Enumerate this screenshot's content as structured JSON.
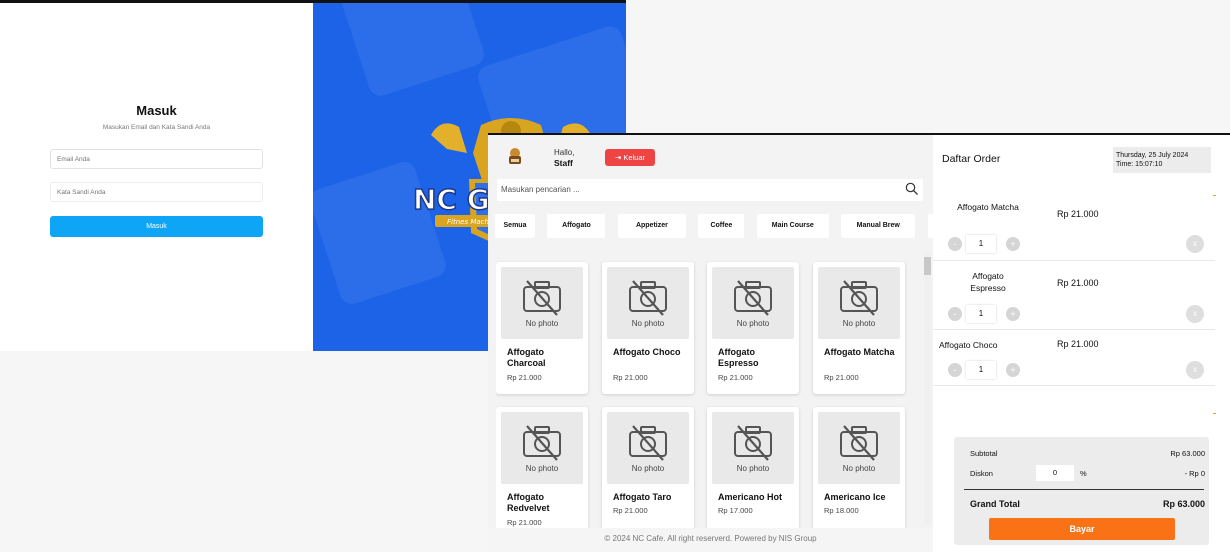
{
  "login": {
    "title": "Masuk",
    "subtitle": "Masukan Email dan Kata Sandi Anda",
    "email_placeholder": "Email Anda",
    "password_placeholder": "Kata Sandi Anda",
    "submit_label": "Masuk",
    "brand_text": "NC GYM",
    "brand_tagline": "Fitnes Machine"
  },
  "pos": {
    "greeting": "Hallo,",
    "user": "Staff",
    "logout_label": "Keluar",
    "search_placeholder": "Masukan pencarian ...",
    "categories": [
      "Semua",
      "Affogato",
      "Appetizer",
      "Coffee",
      "Main Course",
      "Manual Brew"
    ],
    "no_photo": "No photo",
    "products": [
      {
        "name": "Affogato Charcoal",
        "price": "Rp 21.000"
      },
      {
        "name": "Affogato Choco",
        "price": "Rp 21.000"
      },
      {
        "name": "Affogato Espresso",
        "price": "Rp 21.000"
      },
      {
        "name": "Affogato Matcha",
        "price": "Rp 21.000"
      },
      {
        "name": "Affogato Redvelvet",
        "price": "Rp 21.000"
      },
      {
        "name": "Affogato Taro",
        "price": "Rp 21.000"
      },
      {
        "name": "Americano Hot",
        "price": "Rp 17.000"
      },
      {
        "name": "Americano Ice",
        "price": "Rp 18.000"
      }
    ],
    "footer": "© 2024 NC Cafe. All right reserverd. Powered by NIS Group"
  },
  "order": {
    "title": "Daftar Order",
    "date": "Thursday, 25 July 2024",
    "time": "Time: 15:07:10",
    "items": [
      {
        "name": "Affogato Matcha",
        "price": "Rp 21.000",
        "qty": "1"
      },
      {
        "name": "Affogato Espresso",
        "price": "Rp 21.000",
        "qty": "1"
      },
      {
        "name": "Affogato Choco",
        "price": "Rp 21.000",
        "qty": "1"
      }
    ],
    "subtotal_label": "Subtotal",
    "subtotal": "Rp 63.000",
    "discount_label": "Diskon",
    "discount_value": "0",
    "discount_unit": "%",
    "discount_amount": "- Rp 0",
    "grand_total_label": "Grand Total",
    "grand_total": "Rp 63.000",
    "pay_label": "Bayar"
  },
  "colors": {
    "primary_blue": "#1d63e8",
    "login_button": "#0ea5f7",
    "logout": "#ef4444",
    "pay": "#f97316"
  }
}
